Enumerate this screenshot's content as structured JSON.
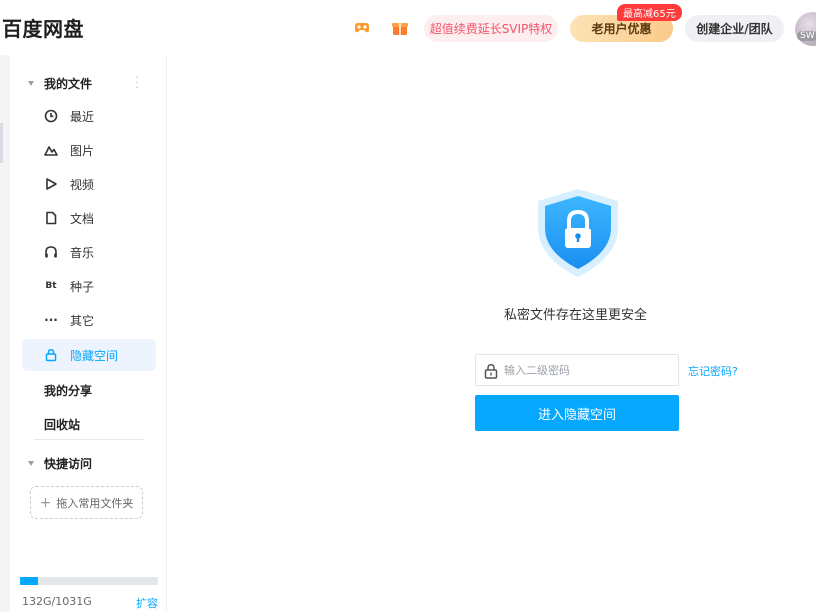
{
  "header": {
    "logo": "百度网盘",
    "svip_label": "超值续费延长SVIP特权",
    "old_user_label": "老用户优惠",
    "promo_tag": "最高减65元",
    "enterprise_label": "创建企业/团队",
    "avatar_text": "SW"
  },
  "sidebar": {
    "my_files": "我的文件",
    "items": [
      {
        "label": "最近",
        "icon": "clock-icon"
      },
      {
        "label": "图片",
        "icon": "image-icon"
      },
      {
        "label": "视频",
        "icon": "play-icon"
      },
      {
        "label": "文档",
        "icon": "document-icon"
      },
      {
        "label": "音乐",
        "icon": "headphones-icon"
      },
      {
        "label": "种子",
        "icon": "bt-icon",
        "glyph": "Bt"
      },
      {
        "label": "其它",
        "icon": "more-icon",
        "glyph": "···"
      },
      {
        "label": "隐藏空间",
        "icon": "lock-icon",
        "active": true
      }
    ],
    "my_share": "我的分享",
    "recycle": "回收站",
    "quick_access": "快捷访问",
    "quick_drop": "拖入常用文件夹",
    "storage": {
      "used_text": "132G/1031G",
      "expand": "扩容",
      "fraction": 0.128
    }
  },
  "main": {
    "tagline": "私密文件存在这里更安全",
    "password_placeholder": "输入二级密码",
    "password_value": "",
    "forgot": "忘记密码?",
    "enter_button": "进入隐藏空间"
  },
  "colors": {
    "accent": "#06a7ff",
    "svip_text": "#f2556b",
    "promo_red": "#ff3a3a"
  }
}
